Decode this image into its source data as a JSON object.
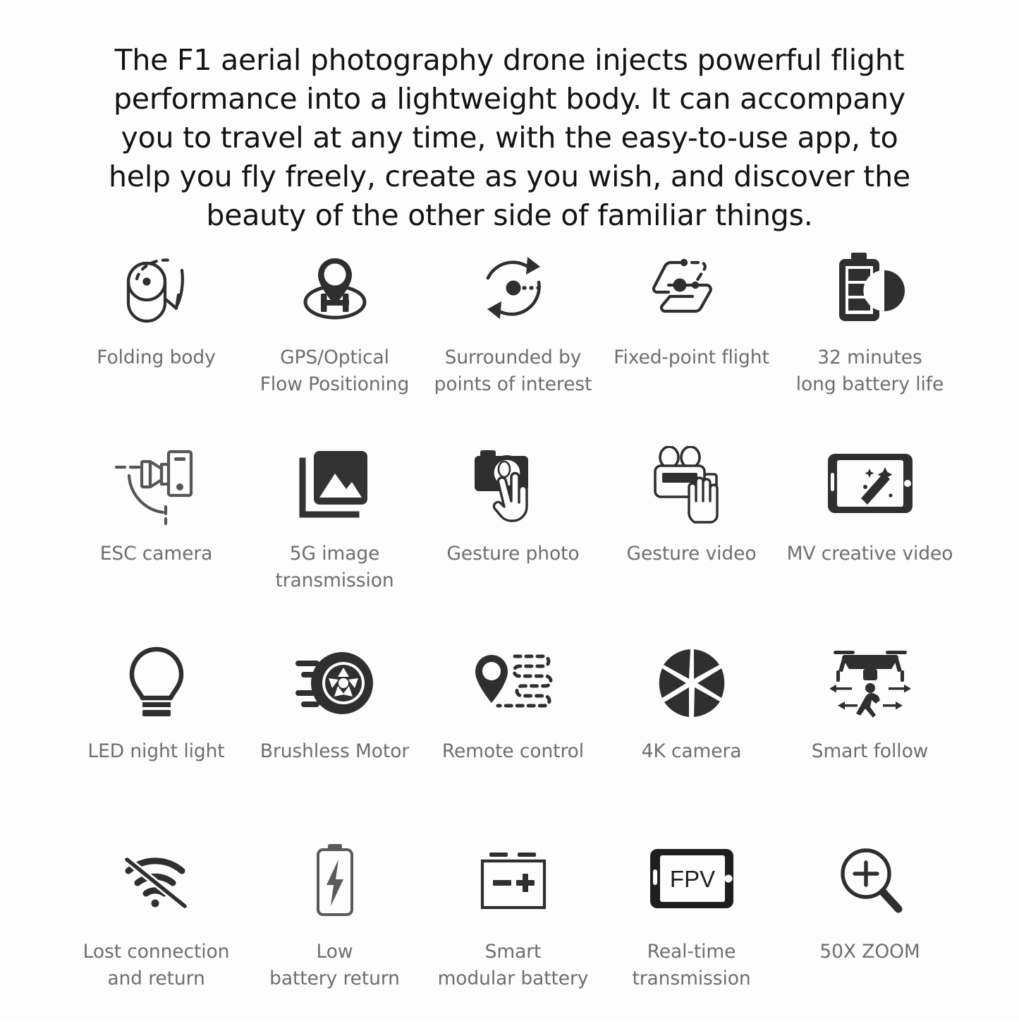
{
  "headline": "The F1 aerial photography drone injects powerful flight performance into a lightweight body. It can accompany you to travel at any time, with the easy-to-use app, to help you fly freely, create as you wish, and discover the beauty of the other side of familiar things.",
  "colors": {
    "background": "#fdfdfd",
    "headline_text": "#131313",
    "label_text": "#6e6e6e",
    "icon_stroke": "#2f2f2f",
    "icon_fill": "#333333"
  },
  "features": [
    {
      "id": "folding-body",
      "icon": "folding-body-icon",
      "label": "Folding body"
    },
    {
      "id": "gps-optical-flow",
      "icon": "map-pin-helipad-icon",
      "label": "GPS/Optical\nFlow Positioning"
    },
    {
      "id": "surround-poi",
      "icon": "orbit-arrows-icon",
      "label": "Surrounded by\npoints of interest"
    },
    {
      "id": "fixed-point-flight",
      "icon": "waypoint-path-icon",
      "label": "Fixed-point flight"
    },
    {
      "id": "battery-life",
      "icon": "battery-clock-icon",
      "label": "32 minutes\nlong battery life"
    },
    {
      "id": "esc-camera",
      "icon": "gimbal-camera-icon",
      "label": "ESC camera"
    },
    {
      "id": "5g-image-transmission",
      "icon": "photo-stack-icon",
      "label": "5G image\ntransmission"
    },
    {
      "id": "gesture-photo",
      "icon": "camera-peace-hand-icon",
      "label": "Gesture photo"
    },
    {
      "id": "gesture-video",
      "icon": "camcorder-palm-icon",
      "label": "Gesture video"
    },
    {
      "id": "mv-creative-video",
      "icon": "tablet-magic-wand-icon",
      "label": "MV creative video"
    },
    {
      "id": "led-night-light",
      "icon": "lightbulb-icon",
      "label": "LED night light"
    },
    {
      "id": "brushless-motor",
      "icon": "wheel-motor-icon",
      "label": "Brushless Motor"
    },
    {
      "id": "remote-control",
      "icon": "pin-dashed-route-icon",
      "label": "Remote control"
    },
    {
      "id": "4k-camera",
      "icon": "aperture-icon",
      "label": "4K camera"
    },
    {
      "id": "smart-follow",
      "icon": "drone-follow-runner-icon",
      "label": "Smart follow"
    },
    {
      "id": "lost-connection",
      "icon": "wifi-off-icon",
      "label": "Lost connection\nand return"
    },
    {
      "id": "low-battery-return",
      "icon": "battery-bolt-icon",
      "label": "Low\nbattery return"
    },
    {
      "id": "smart-modular-battery",
      "icon": "battery-terminals-icon",
      "label": "Smart\nmodular battery"
    },
    {
      "id": "realtime-transmission",
      "icon": "fpv-tablet-icon",
      "label": "Real-time\ntransmission"
    },
    {
      "id": "50x-zoom",
      "icon": "magnifier-plus-icon",
      "label": "50X ZOOM"
    }
  ],
  "icon_text": {
    "helipad": "H",
    "fpv": "FPV"
  }
}
